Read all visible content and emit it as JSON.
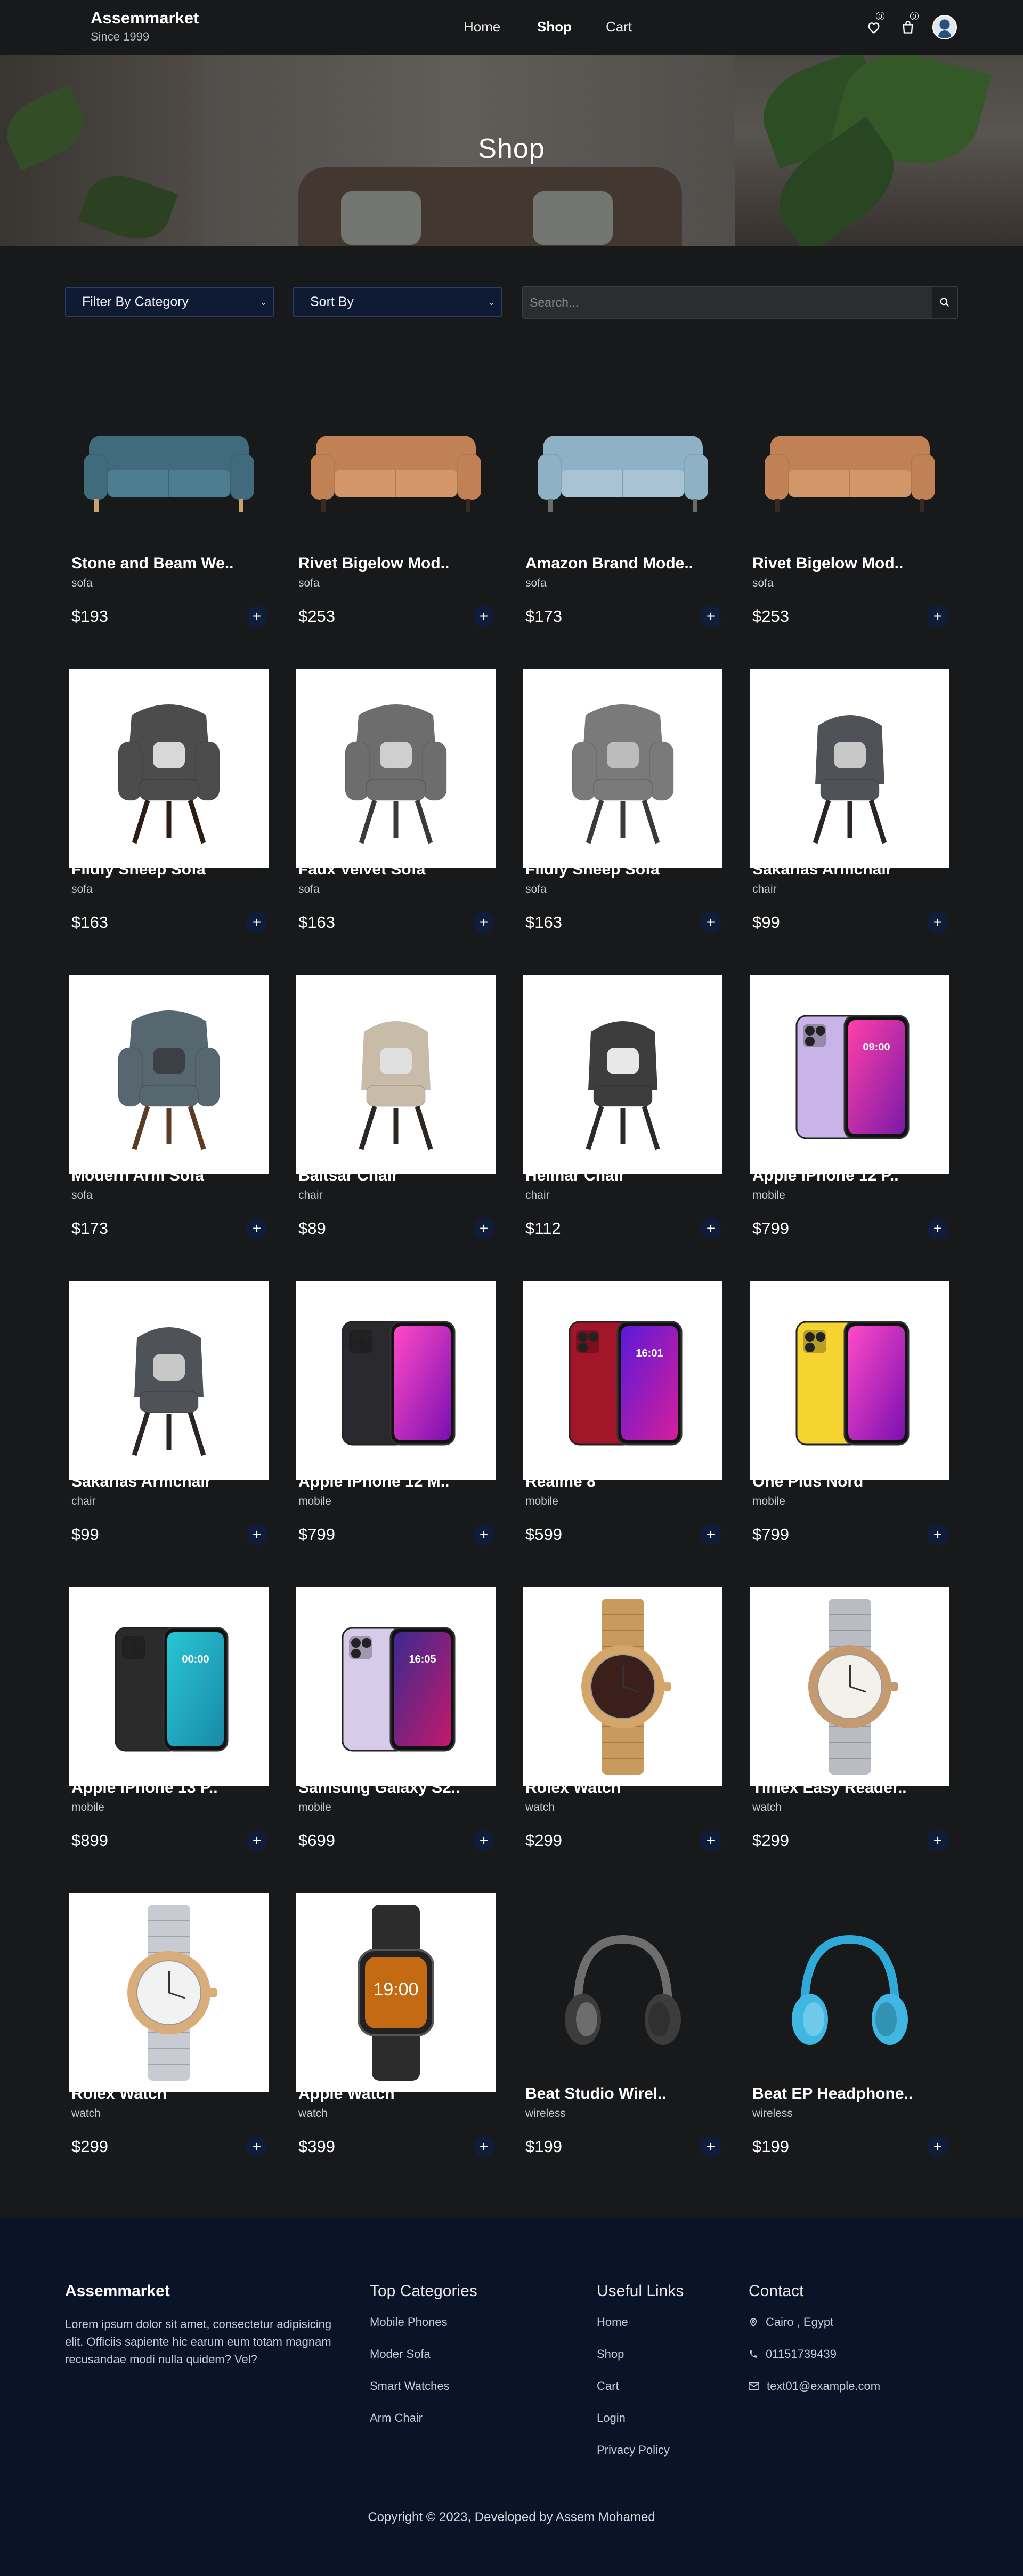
{
  "header": {
    "brand_name": "Assemmarket",
    "brand_since": "Since 1999",
    "nav": {
      "home": "Home",
      "shop": "Shop",
      "cart": "Cart"
    },
    "wishlist_count": "0",
    "cart_count": "0"
  },
  "hero": {
    "title": "Shop"
  },
  "filters": {
    "category_label": "Filter By Category",
    "sort_label": "Sort By",
    "search_placeholder": "Search..."
  },
  "products": [
    {
      "title": "Stone and Beam We..",
      "category": "sofa",
      "price": "$193",
      "image": "sofa-blue"
    },
    {
      "title": "Rivet Bigelow Mod..",
      "category": "sofa",
      "price": "$253",
      "image": "sofa-tan"
    },
    {
      "title": "Amazon Brand Mode..",
      "category": "sofa",
      "price": "$173",
      "image": "sofa-lightblue"
    },
    {
      "title": "Rivet Bigelow Mod..",
      "category": "sofa",
      "price": "$253",
      "image": "sofa-tan"
    },
    {
      "title": "Fllufy Sheep Sofa",
      "category": "sofa",
      "price": "$163",
      "image": "wingchair-dark"
    },
    {
      "title": "Faux Velvet Sofa",
      "category": "sofa",
      "price": "$163",
      "image": "wingchair-grey"
    },
    {
      "title": "Fllufy Sheep Sofa",
      "category": "sofa",
      "price": "$163",
      "image": "wingchair-fur"
    },
    {
      "title": "Sakarias Armchair",
      "category": "chair",
      "price": "$99",
      "image": "swivel-grey"
    },
    {
      "title": "Modern Arm Sofa",
      "category": "sofa",
      "price": "$173",
      "image": "armchair-blue"
    },
    {
      "title": "Baltsar Chair",
      "category": "chair",
      "price": "$89",
      "image": "swivel-beige"
    },
    {
      "title": "Helmar Chair",
      "category": "chair",
      "price": "$112",
      "image": "chair-plaid"
    },
    {
      "title": "Apple iPhone 12 P..",
      "category": "mobile",
      "price": "$799",
      "image": "phone-purple"
    },
    {
      "title": "Sakarias Armchair",
      "category": "chair",
      "price": "$99",
      "image": "swivel-grey"
    },
    {
      "title": "Apple iPhone 12 M..",
      "category": "mobile",
      "price": "$799",
      "image": "phone-black-pink"
    },
    {
      "title": "Realme 8",
      "category": "mobile",
      "price": "$599",
      "image": "phone-red"
    },
    {
      "title": "One Plus Nord",
      "category": "mobile",
      "price": "$799",
      "image": "phone-yellow"
    },
    {
      "title": "Apple iPhone 13 P..",
      "category": "mobile",
      "price": "$899",
      "image": "phone-black-teal"
    },
    {
      "title": "Samsung Galaxy S2..",
      "category": "mobile",
      "price": "$699",
      "image": "phone-lavender"
    },
    {
      "title": "Rolex Watch",
      "category": "watch",
      "price": "$299",
      "image": "watch-gold"
    },
    {
      "title": "Timex Easy Reader..",
      "category": "watch",
      "price": "$299",
      "image": "watch-silver"
    },
    {
      "title": "Rolex Watch",
      "category": "watch",
      "price": "$299",
      "image": "watch-twotone"
    },
    {
      "title": "Apple Watch",
      "category": "watch",
      "price": "$399",
      "image": "smartwatch"
    },
    {
      "title": "Beat Studio Wirel..",
      "category": "wireless",
      "price": "$199",
      "image": "headphones-grey"
    },
    {
      "title": "Beat EP Headphone..",
      "category": "wireless",
      "price": "$199",
      "image": "headphones-blue"
    }
  ],
  "phone_screens": {
    "phone-purple": "09:00",
    "phone-red": "16:01",
    "phone-black-teal": "00:00",
    "phone-lavender": "16:05",
    "smartwatch": "19:00"
  },
  "footer": {
    "brand": "Assemmarket",
    "about": "Lorem ipsum dolor sit amet, consectetur adipisicing elit. Officiis sapiente hic earum eum totam magnam recusandae modi nulla quidem? Vel?",
    "categories_title": "Top Categories",
    "categories": [
      "Mobile Phones",
      "Moder Sofa",
      "Smart Watches",
      "Arm Chair"
    ],
    "links_title": "Useful Links",
    "links": [
      "Home",
      "Shop",
      "Cart",
      "Login",
      "Privacy Policy"
    ],
    "contact_title": "Contact",
    "contact": {
      "address": "Cairo , Egypt",
      "phone": "01151739439",
      "email": "text01@example.com"
    },
    "copyright": "Copyright © 2023, Developed by Assem Mohamed"
  },
  "colors": {
    "page_bg": "#18191b",
    "footer_bg": "#0a1428",
    "button_bg": "#0f1c3a",
    "accent_border": "#2a3e6a"
  }
}
